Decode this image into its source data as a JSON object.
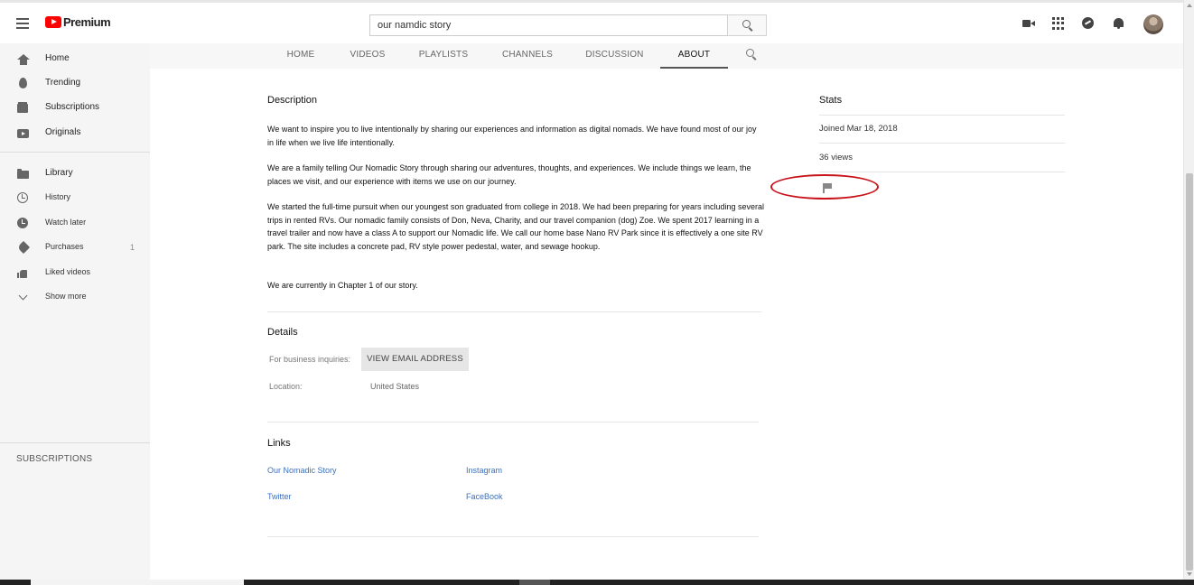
{
  "header": {
    "logo_text": "Premium",
    "search_value": "our namdic story"
  },
  "tabs": [
    {
      "label": "HOME"
    },
    {
      "label": "VIDEOS"
    },
    {
      "label": "PLAYLISTS"
    },
    {
      "label": "CHANNELS"
    },
    {
      "label": "DISCUSSION"
    },
    {
      "label": "ABOUT",
      "active": true
    }
  ],
  "sidebar": {
    "items": [
      {
        "label": "Home",
        "icon": "home-icon"
      },
      {
        "label": "Trending",
        "icon": "trending-icon"
      },
      {
        "label": "Subscriptions",
        "icon": "subscriptions-icon"
      },
      {
        "label": "Originals",
        "icon": "originals-icon"
      },
      {
        "label": "Library",
        "icon": "library-icon"
      },
      {
        "label": "History",
        "icon": "history-icon"
      },
      {
        "label": "Watch later",
        "icon": "watch-later-icon"
      },
      {
        "label": "Purchases",
        "icon": "purchases-icon",
        "count": "1"
      },
      {
        "label": "Liked videos",
        "icon": "liked-videos-icon"
      },
      {
        "label": "Show more",
        "icon": "chevron-down-icon"
      }
    ],
    "subscriptions_heading": "SUBSCRIPTIONS"
  },
  "description": {
    "title": "Description",
    "paragraphs": [
      "We want to inspire you to live intentionally by sharing our experiences and information as digital nomads.  We have found most of our joy in life when we live life intentionally.",
      "We are a family telling Our Nomadic Story through sharing our adventures, thoughts, and experiences.  We include things we learn, the places we visit, and our experience with items we use on our journey.",
      "We started the full-time pursuit when our youngest son graduated from college in 2018.  We had been preparing for years including several trips in rented RVs.  Our nomadic family consists of Don, Neva, Charity, and our travel companion (dog) Zoe.  We spent 2017 learning in a travel trailer and now have a class A to support our Nomadic life.  We call our home base Nano RV Park since it is effectively a one site RV park.  The site includes a concrete pad, RV style power pedestal, water, and sewage hookup.",
      "We are currently in Chapter 1 of our story."
    ]
  },
  "details": {
    "title": "Details",
    "business_label": "For business inquiries:",
    "email_button": "VIEW EMAIL ADDRESS",
    "location_label": "Location:",
    "location_value": "United States"
  },
  "links": {
    "title": "Links",
    "items": [
      "Our Nomadic Story",
      "Instagram",
      "Twitter",
      "FaceBook"
    ]
  },
  "stats": {
    "title": "Stats",
    "joined": "Joined Mar 18, 2018",
    "views": "36 views"
  },
  "colors": {
    "brand_red": "#ff0000",
    "annotation_red": "#c8131a",
    "link_blue": "#3a6fbf"
  }
}
